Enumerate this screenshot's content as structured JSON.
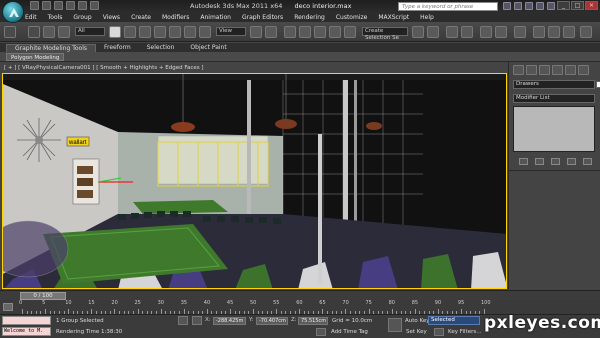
{
  "window": {
    "app_title": "Autodesk 3ds Max  2011 x64",
    "file_name": "deco interior.max"
  },
  "search": {
    "placeholder": "Type a keyword or phrase"
  },
  "window_controls": {
    "minimize": "_",
    "maximize": "□",
    "close": "×"
  },
  "menu": [
    "Edit",
    "Tools",
    "Group",
    "Views",
    "Create",
    "Modifiers",
    "Animation",
    "Graph Editors",
    "Rendering",
    "Customize",
    "MAXScript",
    "Help"
  ],
  "toolbar": {
    "filter_value": "All",
    "view_value": "View",
    "selection_set": "Create Selection Se"
  },
  "ribbon": {
    "tabs": [
      "Graphite Modeling Tools",
      "Freeform",
      "Selection",
      "Object Paint"
    ],
    "panel_button": "Polygon Modeling"
  },
  "viewport": {
    "label": "[ + ] [ VRayPhysicalCamera001 ] [ Smooth + Highlights + Edged Faces ]",
    "tag_label": "wallart"
  },
  "command_panel": {
    "drawers": "Drawers",
    "modifier_list": "Modifier List"
  },
  "time": {
    "slider": "0 / 100",
    "ticks": [
      "0",
      "5",
      "10",
      "15",
      "20",
      "25",
      "30",
      "35",
      "40",
      "45",
      "50",
      "55",
      "60",
      "65",
      "70",
      "75",
      "80",
      "85",
      "90",
      "95",
      "100"
    ]
  },
  "status": {
    "listener_text": "Welcome to M.",
    "selection_info": "1 Group Selected",
    "rendering_time": "Rendering Time  1:38:30",
    "x_value": "-288.425m",
    "y_value": "-70.407cm",
    "z_value": "75.515cm",
    "x_label": "X:",
    "y_label": "Y:",
    "z_label": "Z:",
    "grid": "Grid = 10.0cm",
    "add_time_tag": "Add Time Tag",
    "auto_key": "Auto Key",
    "auto_key_value": "Selected",
    "set_key": "Set Key",
    "key_filters": "Key Filters..."
  },
  "watermark": "pxleyes.com",
  "colors": {
    "viewport_border": "#ffd400",
    "auto_key": "#2a4a7c",
    "carpet_green": "#3f7a2c",
    "listener_pink": "#f4d4d4"
  }
}
